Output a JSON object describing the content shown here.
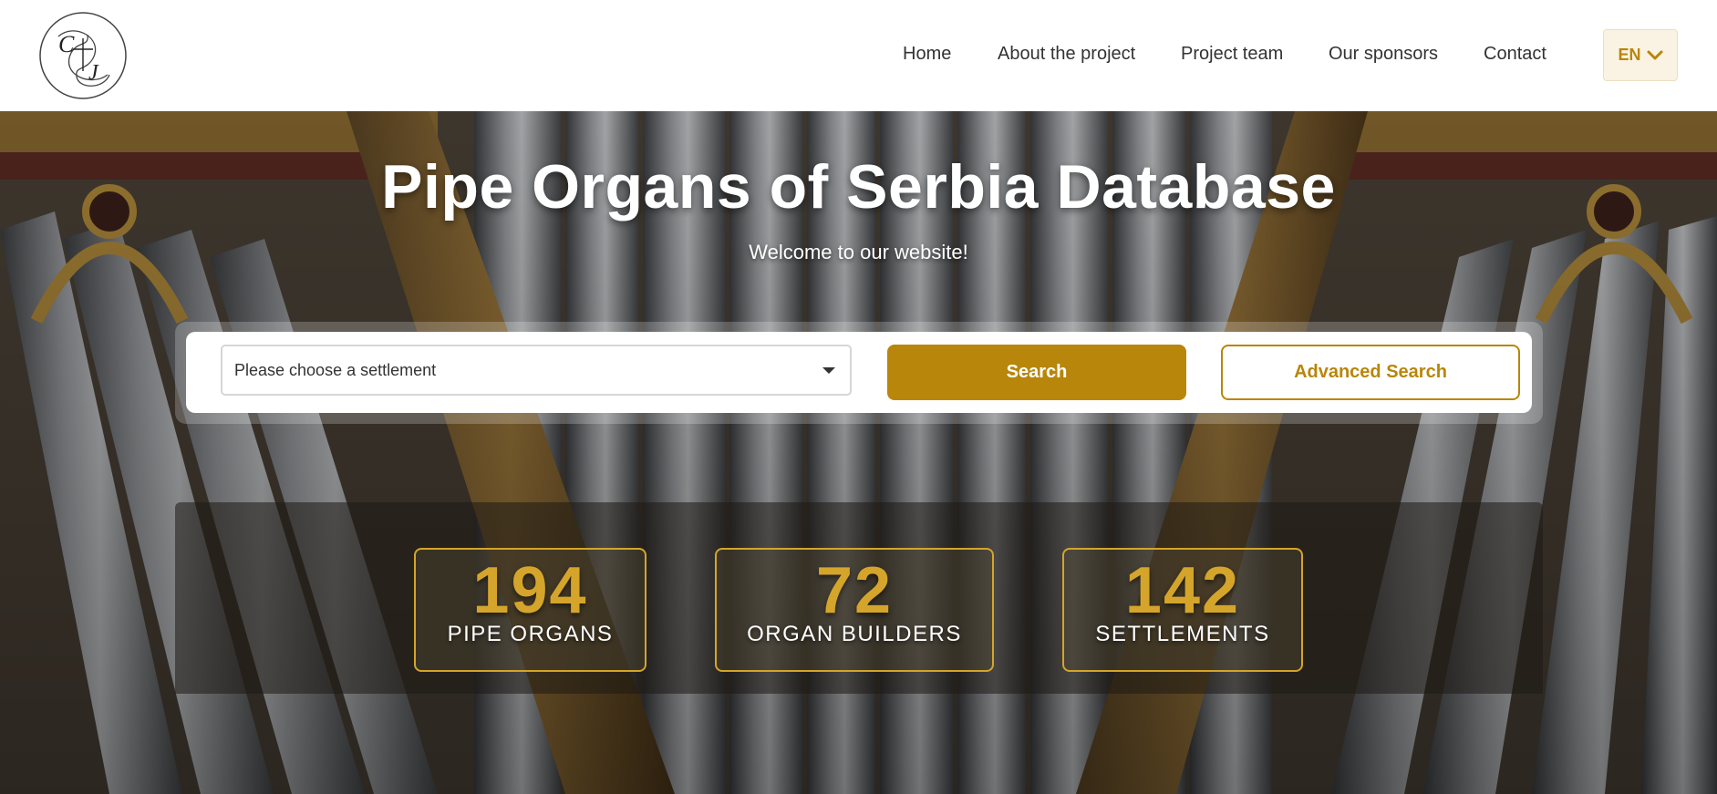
{
  "logo": {
    "alt": "C J"
  },
  "nav": {
    "items": [
      {
        "label": "Home"
      },
      {
        "label": "About the project"
      },
      {
        "label": "Project team"
      },
      {
        "label": "Our sponsors"
      },
      {
        "label": "Contact"
      }
    ],
    "language": "EN"
  },
  "hero": {
    "title": "Pipe Organs of Serbia Database",
    "subtitle": "Welcome to our website!"
  },
  "search": {
    "settlement_placeholder": "Please choose a settlement",
    "search_label": "Search",
    "advanced_label": "Advanced Search"
  },
  "stats": [
    {
      "value": "194",
      "label": "PIPE ORGANS"
    },
    {
      "value": "72",
      "label": "ORGAN BUILDERS"
    },
    {
      "value": "142",
      "label": "SETTLEMENTS"
    }
  ],
  "colors": {
    "accent": "#b8860b",
    "stat_gold": "#d4a52a",
    "header_bg": "#ffffff"
  },
  "icons": {
    "logo": "logo-monogram-icon",
    "language_chevron": "chevron-down-icon",
    "select_caret": "caret-down-icon"
  }
}
